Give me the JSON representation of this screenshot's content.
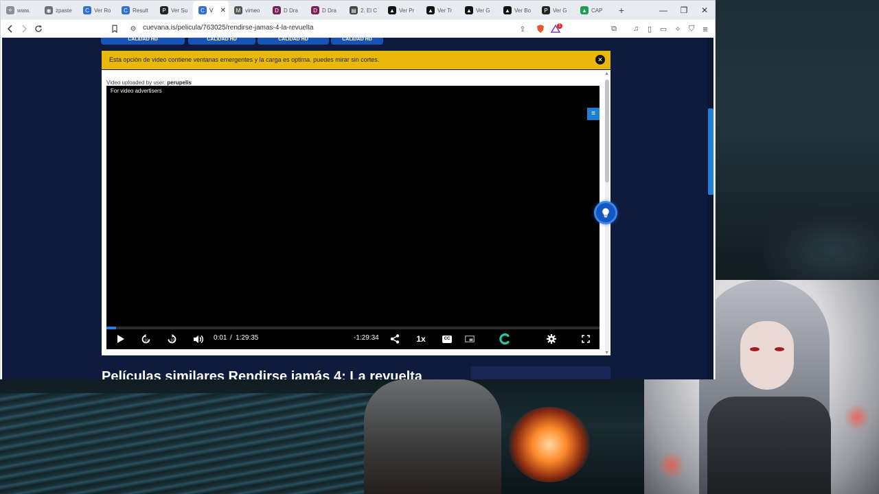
{
  "browser": {
    "tabs": [
      {
        "label": "www.",
        "icon": "globe-icon",
        "color": "#8a8f98",
        "glyph": "⟡"
      },
      {
        "label": "zpaste",
        "icon": "circle-icon",
        "color": "#6b6f77",
        "glyph": "◉"
      },
      {
        "label": "Ver Ro",
        "icon": "cuevana-icon",
        "color": "#2f6fd6",
        "glyph": "C"
      },
      {
        "label": "Result",
        "icon": "cuevana-icon",
        "color": "#2f6fd6",
        "glyph": "C"
      },
      {
        "label": "Ver Su",
        "icon": "p-icon",
        "color": "#222222",
        "glyph": "P"
      },
      {
        "label": "V",
        "icon": "cuevana-icon",
        "color": "#2f6fd6",
        "glyph": "C",
        "active": true
      },
      {
        "label": "vimeo",
        "icon": "m-icon",
        "color": "#555555",
        "glyph": "M"
      },
      {
        "label": "D Dra",
        "icon": "d-icon",
        "color": "#7b1f5a",
        "glyph": "D"
      },
      {
        "label": "D Dra",
        "icon": "d-icon",
        "color": "#7b1f5a",
        "glyph": "D"
      },
      {
        "label": "2. El C",
        "icon": "doc-icon",
        "color": "#444444",
        "glyph": "▤"
      },
      {
        "label": "Ver Pr",
        "icon": "a-icon",
        "color": "#111111",
        "glyph": "▲"
      },
      {
        "label": "Ver Tr",
        "icon": "a-icon",
        "color": "#111111",
        "glyph": "▲"
      },
      {
        "label": "Ver G",
        "icon": "a-icon",
        "color": "#111111",
        "glyph": "▲"
      },
      {
        "label": "Ver Bo",
        "icon": "a-icon",
        "color": "#111111",
        "glyph": "▲"
      },
      {
        "label": "Ver G",
        "icon": "p-icon",
        "color": "#222222",
        "glyph": "P"
      },
      {
        "label": "CAP",
        "icon": "drive-icon",
        "color": "#1f9d55",
        "glyph": "▲"
      }
    ],
    "url": "cuevana.is/pelicula/763025/rendirse-jamas-4-la-revuelta",
    "brave_badge": "1"
  },
  "page": {
    "quality_tabs": [
      "CALIDAD HD",
      "CALIDAD HD",
      "CALIDAD HD",
      "CALIDAD HD"
    ],
    "notice": "Esta opción de video contiene ventanas emergentes y la carga es optima. puedes mirar sin cortes.",
    "uploader_prefix": "Video uploaded by user:",
    "uploader_name": "perupelis",
    "advertisers_label": "For video advertisers",
    "similar_title": "Películas similares Rendirse jamás 4: La revuelta"
  },
  "player": {
    "current_time": "0:01",
    "separator": "/",
    "duration": "1:29:35",
    "remaining": "-1:29:34",
    "speed": "1x",
    "cc_label": "CC",
    "progress": 0.02,
    "accent": "#2a7de1"
  },
  "colors": {
    "page_bg": "#0e1b3c",
    "notice_bg": "#e9b80d",
    "scroll_thumb": "#1f7fd9"
  }
}
